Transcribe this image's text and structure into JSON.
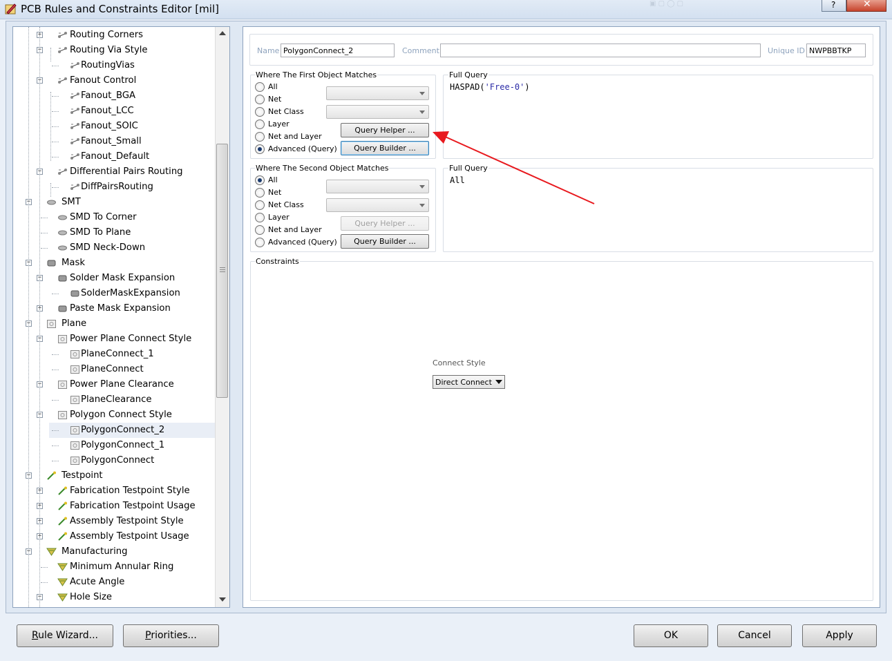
{
  "window": {
    "title": "PCB Rules and Constraints Editor [mil]",
    "help": "?"
  },
  "tree": {
    "items": [
      {
        "label": "Routing Corners",
        "icon": "route-icon",
        "exp": "+"
      },
      {
        "label": "Routing Via Style",
        "icon": "route-icon",
        "exp": "-"
      },
      {
        "label": "RoutingVias",
        "icon": "route-icon",
        "exp": ""
      },
      {
        "label": "Fanout Control",
        "icon": "route-icon",
        "exp": "-"
      },
      {
        "label": "Fanout_BGA",
        "icon": "route-icon",
        "exp": ""
      },
      {
        "label": "Fanout_LCC",
        "icon": "route-icon",
        "exp": ""
      },
      {
        "label": "Fanout_SOIC",
        "icon": "route-icon",
        "exp": ""
      },
      {
        "label": "Fanout_Small",
        "icon": "route-icon",
        "exp": ""
      },
      {
        "label": "Fanout_Default",
        "icon": "route-icon",
        "exp": ""
      },
      {
        "label": "Differential Pairs Routing",
        "icon": "route-icon",
        "exp": "-"
      },
      {
        "label": "DiffPairsRouting",
        "icon": "route-icon",
        "exp": ""
      },
      {
        "label": "SMT",
        "icon": "smt-icon",
        "exp": "-"
      },
      {
        "label": "SMD To Corner",
        "icon": "smt-icon",
        "exp": ""
      },
      {
        "label": "SMD To Plane",
        "icon": "smt-icon",
        "exp": ""
      },
      {
        "label": "SMD Neck-Down",
        "icon": "smt-icon",
        "exp": ""
      },
      {
        "label": "Mask",
        "icon": "mask-icon",
        "exp": "-"
      },
      {
        "label": "Solder Mask Expansion",
        "icon": "mask-icon",
        "exp": "-"
      },
      {
        "label": "SolderMaskExpansion",
        "icon": "mask-icon",
        "exp": ""
      },
      {
        "label": "Paste Mask Expansion",
        "icon": "mask-icon",
        "exp": "+"
      },
      {
        "label": "Plane",
        "icon": "plane-icon",
        "exp": "-"
      },
      {
        "label": "Power Plane Connect Style",
        "icon": "plane-icon",
        "exp": "-"
      },
      {
        "label": "PlaneConnect_1",
        "icon": "plane-icon",
        "exp": ""
      },
      {
        "label": "PlaneConnect",
        "icon": "plane-icon",
        "exp": ""
      },
      {
        "label": "Power Plane Clearance",
        "icon": "plane-icon",
        "exp": "-"
      },
      {
        "label": "PlaneClearance",
        "icon": "plane-icon",
        "exp": ""
      },
      {
        "label": "Polygon Connect Style",
        "icon": "plane-icon",
        "exp": "-"
      },
      {
        "label": "PolygonConnect_2",
        "icon": "plane-icon",
        "exp": "",
        "selected": true
      },
      {
        "label": "PolygonConnect_1",
        "icon": "plane-icon",
        "exp": ""
      },
      {
        "label": "PolygonConnect",
        "icon": "plane-icon",
        "exp": ""
      },
      {
        "label": "Testpoint",
        "icon": "testpoint-icon",
        "exp": "-"
      },
      {
        "label": "Fabrication Testpoint Style",
        "icon": "testpoint-icon",
        "exp": "+"
      },
      {
        "label": "Fabrication Testpoint Usage",
        "icon": "testpoint-icon",
        "exp": "+"
      },
      {
        "label": "Assembly Testpoint Style",
        "icon": "testpoint-icon",
        "exp": "+"
      },
      {
        "label": "Assembly Testpoint Usage",
        "icon": "testpoint-icon",
        "exp": "+"
      },
      {
        "label": "Manufacturing",
        "icon": "manufacturing-icon",
        "exp": "-"
      },
      {
        "label": "Minimum Annular Ring",
        "icon": "manufacturing-icon",
        "exp": ""
      },
      {
        "label": "Acute Angle",
        "icon": "manufacturing-icon",
        "exp": ""
      },
      {
        "label": "Hole Size",
        "icon": "manufacturing-icon",
        "exp": "-"
      }
    ]
  },
  "rule": {
    "name_label": "Name",
    "name_value": "PolygonConnect_2",
    "comment_label": "Comment",
    "comment_value": "",
    "uid_label": "Unique ID",
    "uid_value": "NWPBBTKP"
  },
  "first": {
    "title": "Where The First Object Matches",
    "options": [
      "All",
      "Net",
      "Net Class",
      "Layer",
      "Net and Layer",
      "Advanced (Query)"
    ],
    "selected": "Advanced (Query)",
    "query_helper": "Query Helper ...",
    "query_builder": "Query Builder ...",
    "full_query_label": "Full Query",
    "full_query_fn": "HASPAD(",
    "full_query_arg": "'Free-0'",
    "full_query_close": ")"
  },
  "second": {
    "title": "Where The Second Object Matches",
    "options": [
      "All",
      "Net",
      "Net Class",
      "Layer",
      "Net and Layer",
      "Advanced (Query)"
    ],
    "selected": "All",
    "query_helper": "Query Helper ...",
    "query_builder": "Query Builder ...",
    "full_query_label": "Full Query",
    "full_query": "All"
  },
  "constraints": {
    "title": "Constraints",
    "connect_style_label": "Connect Style",
    "connect_style_value": "Direct Connect"
  },
  "buttons": {
    "rule_wizard": "Rule Wizard...",
    "priorities": "Priorities...",
    "ok": "OK",
    "cancel": "Cancel",
    "apply": "Apply"
  },
  "colors": {
    "annotation_arrow": "#e8191e",
    "query_string": "#2a2aa6",
    "selection": "#e9eef6"
  }
}
